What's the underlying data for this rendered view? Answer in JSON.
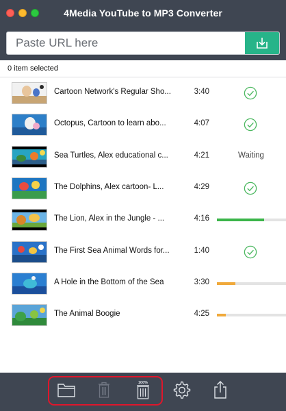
{
  "window": {
    "title": "4Media YouTube to MP3 Converter"
  },
  "url_bar": {
    "placeholder": "Paste URL here",
    "value": ""
  },
  "selection": {
    "label": "0 item selected"
  },
  "items": [
    {
      "title": "Cartoon Network's Regular Sho...",
      "duration": "3:40",
      "status": "done"
    },
    {
      "title": "Octopus, Cartoon to learn abo...",
      "duration": "4:07",
      "status": "done"
    },
    {
      "title": "Sea Turtles, Alex educational c...",
      "duration": "4:21",
      "status": "waiting",
      "status_text": "Waiting"
    },
    {
      "title": "The Dolphins, Alex cartoon- L...",
      "duration": "4:29",
      "status": "done"
    },
    {
      "title": "The Lion, Alex in the Jungle - ...",
      "duration": "4:16",
      "status": "progress",
      "progress": 0.68
    },
    {
      "title": "The First Sea Animal Words for...",
      "duration": "1:40",
      "status": "done"
    },
    {
      "title": "A Hole in the Bottom of the Sea",
      "duration": "3:30",
      "status": "progress",
      "progress": 0.27
    },
    {
      "title": "The Animal Boogie",
      "duration": "4:25",
      "status": "progress",
      "progress": 0.13
    }
  ],
  "colors": {
    "chrome": "#3f4652",
    "accent": "#27b489",
    "progress_green": "#3bb54a",
    "progress_orange": "#f0a93b",
    "check_green": "#4cb860",
    "highlight_red": "#e0162b"
  },
  "toolbar": {
    "buttons": [
      {
        "name": "open-folder-button",
        "icon": "folder-icon",
        "enabled": true
      },
      {
        "name": "delete-button",
        "icon": "trash-icon",
        "enabled": false
      },
      {
        "name": "delete-all-button",
        "icon": "trash-all-icon",
        "enabled": true,
        "badge": "100%"
      },
      {
        "name": "settings-button",
        "icon": "gear-icon",
        "enabled": true
      },
      {
        "name": "export-button",
        "icon": "share-icon",
        "enabled": true
      }
    ]
  }
}
